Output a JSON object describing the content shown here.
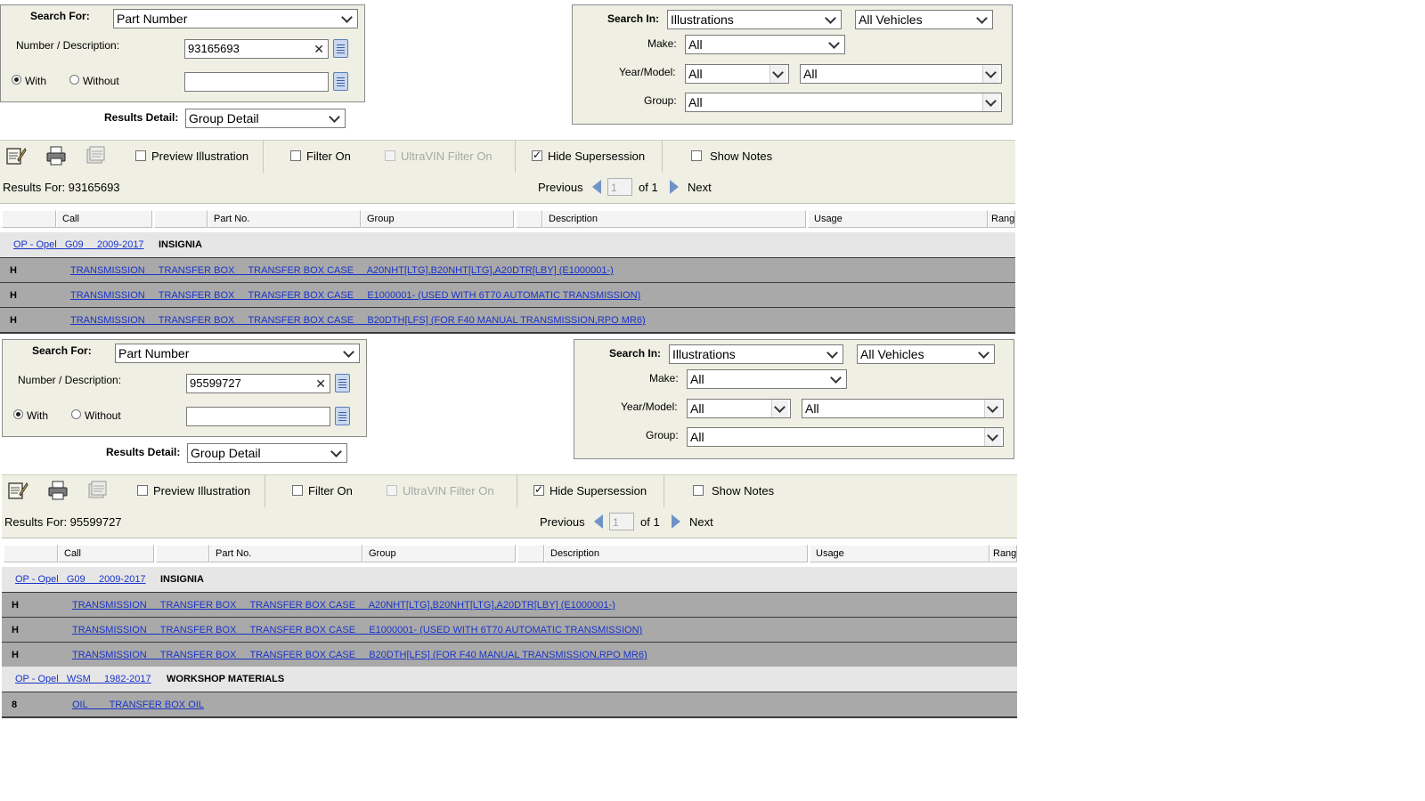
{
  "panels": [
    {
      "search_for_label": "Search For:",
      "search_for_value": "Part Number",
      "number_desc_label": "Number / Description:",
      "number_value": "93165693",
      "with_label": "With",
      "without_label": "Without",
      "results_detail_label": "Results Detail:",
      "results_detail_value": "Group Detail",
      "search_in_label": "Search In:",
      "search_in_value": "Illustrations",
      "vehicles_value": "All Vehicles",
      "make_label": "Make:",
      "make_value": "All",
      "year_model_label": "Year/Model:",
      "year_value": "All",
      "model_value": "All",
      "group_label": "Group:",
      "group_value": "All",
      "toolbar": {
        "preview": "Preview Illustration",
        "filter_on": "Filter On",
        "ultravin": "UltraVIN Filter On",
        "hide_supersession": "Hide Supersession",
        "show_notes": "Show Notes"
      },
      "results_for": "Results For: 93165693",
      "previous": "Previous",
      "page": "1",
      "of": "of 1",
      "next": "Next",
      "columns": [
        "Call",
        "Part No.",
        "Group",
        "Description",
        "Usage",
        "Rang"
      ],
      "groups": [
        {
          "link": "OP - Opel   G09     2009-2017",
          "name": "INSIGNIA",
          "items": [
            {
              "code": "H",
              "text": "TRANSMISSION     TRANSFER BOX     TRANSFER BOX CASE     A20NHT[LTG],B20NHT[LTG],A20DTR[LBY] (E1000001-)"
            },
            {
              "code": "H",
              "text": "TRANSMISSION     TRANSFER BOX     TRANSFER BOX CASE     E1000001- (USED WITH 6T70 AUTOMATIC TRANSMISSION)"
            },
            {
              "code": "H",
              "text": "TRANSMISSION     TRANSFER BOX     TRANSFER BOX CASE     B20DTH[LFS] (FOR F40 MANUAL TRANSMISSION,RPO MR6)"
            }
          ]
        }
      ]
    },
    {
      "search_for_label": "Search For:",
      "search_for_value": "Part Number",
      "number_desc_label": "Number / Description:",
      "number_value": "95599727",
      "with_label": "With",
      "without_label": "Without",
      "results_detail_label": "Results Detail:",
      "results_detail_value": "Group Detail",
      "search_in_label": "Search In:",
      "search_in_value": "Illustrations",
      "vehicles_value": "All Vehicles",
      "make_label": "Make:",
      "make_value": "All",
      "year_model_label": "Year/Model:",
      "year_value": "All",
      "model_value": "All",
      "group_label": "Group:",
      "group_value": "All",
      "toolbar": {
        "preview": "Preview Illustration",
        "filter_on": "Filter On",
        "ultravin": "UltraVIN Filter On",
        "hide_supersession": "Hide Supersession",
        "show_notes": "Show Notes"
      },
      "results_for": "Results For: 95599727",
      "previous": "Previous",
      "page": "1",
      "of": "of 1",
      "next": "Next",
      "columns": [
        "Call",
        "Part No.",
        "Group",
        "Description",
        "Usage",
        "Rang"
      ],
      "groups": [
        {
          "link": "OP - Opel   G09     2009-2017",
          "name": "INSIGNIA",
          "items": [
            {
              "code": "H",
              "text": "TRANSMISSION     TRANSFER BOX     TRANSFER BOX CASE     A20NHT[LTG],B20NHT[LTG],A20DTR[LBY] (E1000001-)"
            },
            {
              "code": "H",
              "text": "TRANSMISSION     TRANSFER BOX     TRANSFER BOX CASE     E1000001- (USED WITH 6T70 AUTOMATIC TRANSMISSION)"
            },
            {
              "code": "H",
              "text": "TRANSMISSION     TRANSFER BOX     TRANSFER BOX CASE     B20DTH[LFS] (FOR F40 MANUAL TRANSMISSION,RPO MR6)"
            }
          ]
        },
        {
          "link": "OP - Opel   WSM     1982-2017",
          "name": "WORKSHOP MATERIALS",
          "items": [
            {
              "code": "8",
              "text": "OIL        TRANSFER BOX OIL"
            }
          ]
        }
      ]
    }
  ]
}
